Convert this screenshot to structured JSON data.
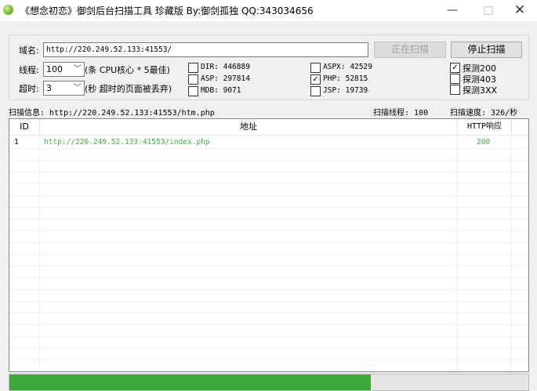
{
  "window": {
    "title": "《想念初恋》御剑后台扫描工具 珍藏版 By:御剑孤独 QQ:343034656",
    "min_symbol": "—",
    "max_symbol": "□",
    "close_symbol": "✕"
  },
  "config": {
    "domain_label": "域名:",
    "domain_value": "http://220.249.52.133:41553/",
    "scanning_button": "正在扫描",
    "stop_button": "停止扫描",
    "threads_label": "线程:",
    "threads_value": "100",
    "threads_hint": "(条 CPU核心 * 5最佳)",
    "timeout_label": "超时:",
    "timeout_value": "3",
    "timeout_hint": "(秒 超时的页面被丢弃)",
    "dicts": [
      {
        "label": "DIR: 446889",
        "checked": false
      },
      {
        "label": "ASP: 297814",
        "checked": false
      },
      {
        "label": "MDB: 9071",
        "checked": false
      },
      {
        "label": "ASPX: 42529",
        "checked": false
      },
      {
        "label": "PHP: 52815",
        "checked": true
      },
      {
        "label": "JSP: 19739",
        "checked": false
      }
    ],
    "probes": [
      {
        "label": "探测200",
        "checked": true
      },
      {
        "label": "探测403",
        "checked": false
      },
      {
        "label": "探测3XX",
        "checked": false
      }
    ],
    "check_mark": "✓"
  },
  "status": {
    "scan_info": "扫描信息: http://220.249.52.133:41553/htm.php",
    "scan_threads": "扫描线程: 100",
    "scan_speed": "扫描速度: 326/秒"
  },
  "results": {
    "headers": [
      "ID",
      "地址",
      "HTTP响应"
    ],
    "rows": [
      {
        "id": "1",
        "url": "http://220.249.52.133:41553/index.php",
        "code": "200"
      }
    ],
    "link_color": "#3cb93c"
  },
  "progress": {
    "fraction": 0.697,
    "color": "#3ca83c"
  }
}
